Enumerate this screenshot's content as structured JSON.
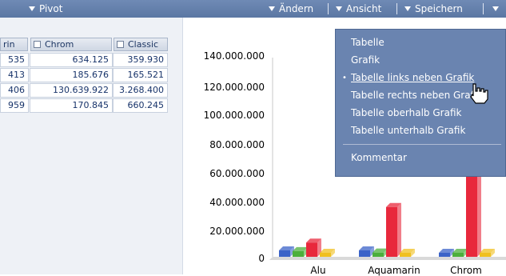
{
  "toolbar": {
    "pivot_label": "Pivot",
    "aendern_label": "Ändern",
    "ansicht_label": "Ansicht",
    "speichern_label": "Speichern"
  },
  "table": {
    "columns": [
      "rin",
      "Chrom",
      "Classic"
    ],
    "rows": [
      [
        "535",
        "634.125",
        "359.930"
      ],
      [
        "413",
        "185.676",
        "165.521"
      ],
      [
        "406",
        "130.639.922",
        "3.268.400"
      ],
      [
        "959",
        "170.845",
        "660.245"
      ]
    ]
  },
  "menu": {
    "items": [
      "Tabelle",
      "Grafik",
      "Tabelle links neben Grafik",
      "Tabelle rechts neben Grafik",
      "Tabelle oberhalb Grafik",
      "Tabelle unterhalb Grafik"
    ],
    "selected_bullet": "•",
    "comment_label": "Kommentar"
  },
  "chart_data": {
    "type": "bar",
    "categories": [
      "Alu",
      "Aquamarin",
      "Chrom"
    ],
    "ytick_labels": [
      "140.000.000",
      "120.000.000",
      "100.000.000",
      "80.000.000",
      "60.000.000",
      "40.000.000",
      "20.000.000",
      "0"
    ],
    "ylim": [
      0,
      140000000
    ],
    "colors": [
      "#3b63c8",
      "#4caf3c",
      "#e8283c",
      "#f0c020"
    ],
    "series": [
      {
        "values": [
          4500000,
          4500000,
          634125
        ]
      },
      {
        "values": [
          4000000,
          3000000,
          185676
        ]
      },
      {
        "values": [
          10000000,
          35000000,
          130639922
        ]
      },
      {
        "values": [
          2500000,
          1500000,
          359930
        ]
      }
    ]
  },
  "colors": {
    "toolbar": "#5f7aa7",
    "menu": "#6a84b0",
    "table_text": "#17336a"
  }
}
